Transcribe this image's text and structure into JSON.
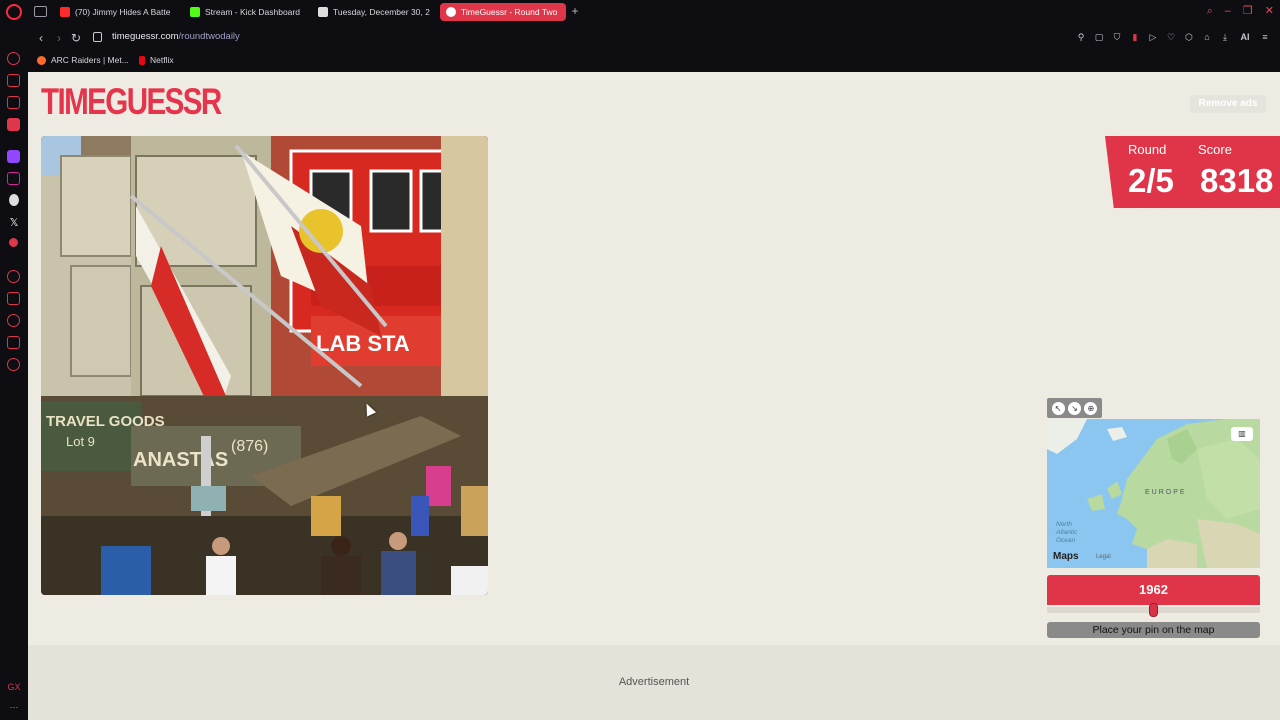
{
  "browser": {
    "tabs": [
      {
        "label": "(70) Jimmy Hides A Batte",
        "favicon_color": "#ff2a2a",
        "active": false
      },
      {
        "label": "Stream - Kick Dashboard",
        "favicon_color": "#53fc18",
        "active": false
      },
      {
        "label": "Tuesday, December 30, 2",
        "favicon_color": "#dddddd",
        "active": false
      },
      {
        "label": "TimeGuessr - Round Two",
        "favicon_color": "#ffffff",
        "active": true
      }
    ],
    "new_tab_icon": "plus-icon",
    "url_host": "timeguessr.com",
    "url_path": "/roundtwodaily",
    "ai_label": "AI",
    "bookmarks": [
      {
        "label": "ARC Raiders | Met...",
        "favicon_color": "#ff6a2a"
      },
      {
        "label": "Netflix",
        "favicon_color": "#e50914"
      }
    ],
    "sidebar_bottom_label": "GX"
  },
  "page": {
    "logo_text": "TIMEGUESSR",
    "remove_ads_label": "Remove ads",
    "score_panel": {
      "round_label": "Round",
      "round_value": "2/5",
      "score_label": "Score",
      "score_value": "8318"
    },
    "map": {
      "region_label": "EUROPE",
      "ocean_label_line1": "North",
      "ocean_label_line2": "Atlantic",
      "ocean_label_line3": "Ocean",
      "brand_label": "Maps",
      "legal_label": "Legal"
    },
    "year_value": "1962",
    "year_slider_fraction": 0.5,
    "pin_prompt": "Place your pin on the map",
    "advertisement_label": "Advertisement",
    "photo_signs": {
      "sign_left": "TRAVEL GOODS",
      "sign_left_sub": "Lot 9",
      "sign_mid": "ANASTAS",
      "sign_number": "(876)",
      "sign_balcony": "LAB STA"
    }
  },
  "colors": {
    "brand_red": "#e03448",
    "page_bg": "#eeebe3",
    "browser_bg": "#0d0d12"
  }
}
